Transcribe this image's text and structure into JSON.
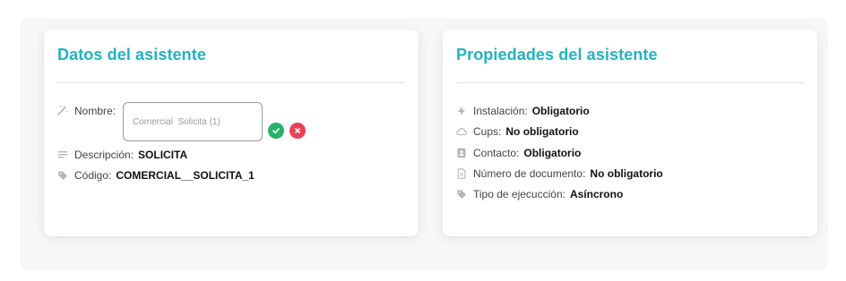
{
  "left_card": {
    "title": "Datos del asistente",
    "name_label": "Nombre:",
    "name_value": "Comercial  Solicita (1)",
    "description_label": "Descripción:",
    "description_value": "SOLICITA",
    "code_label": "Código:",
    "code_value": "COMERCIAL__SOLICITA_1"
  },
  "right_card": {
    "title": "Propiedades del asistente",
    "properties": [
      {
        "label": "Instalación:",
        "value": "Obligatorio",
        "icon": "bolt-icon"
      },
      {
        "label": "Cups:",
        "value": "No obligatorio",
        "icon": "cloud-icon"
      },
      {
        "label": "Contacto:",
        "value": "Obligatorio",
        "icon": "contact-icon"
      },
      {
        "label": "Número de documento:",
        "value": "No obligatorio",
        "icon": "document-icon"
      },
      {
        "label": "Tipo de ejecucción:",
        "value": "Asíncrono",
        "icon": "tag-icon"
      }
    ]
  },
  "colors": {
    "title": "#22b3c3",
    "confirm": "#23b36a",
    "cancel": "#e94257",
    "icon": "#b5b5b5"
  }
}
